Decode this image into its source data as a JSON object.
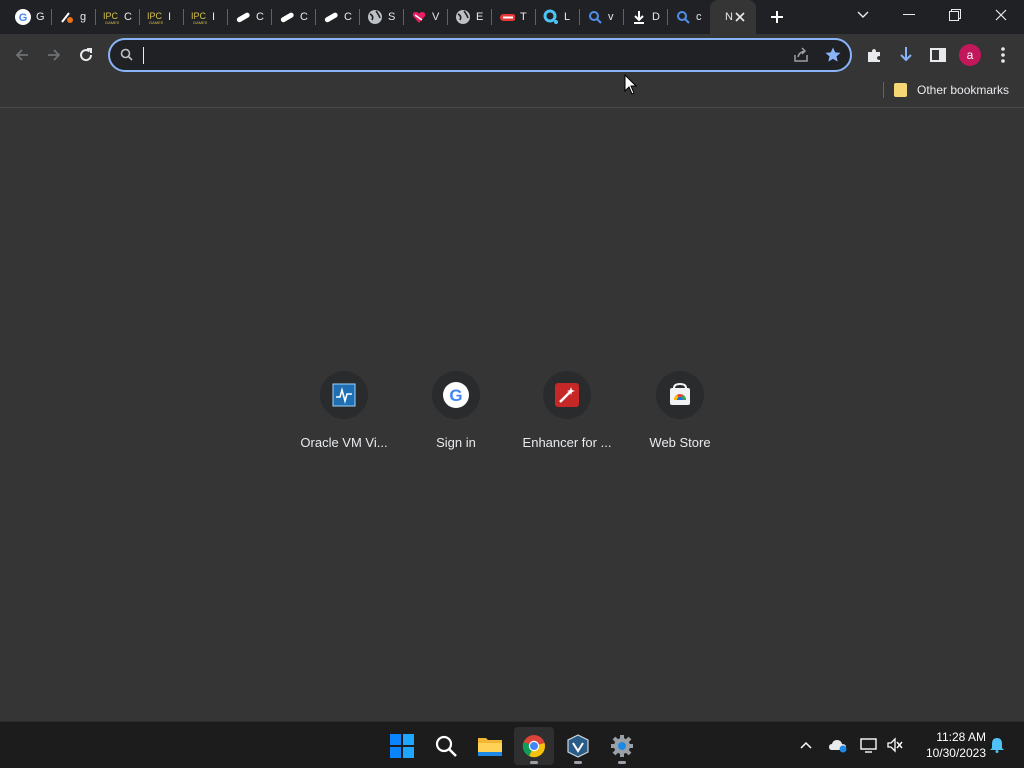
{
  "tabs": [
    {
      "title": "G",
      "icon": "google-icon"
    },
    {
      "title": "g",
      "icon": "game-icon"
    },
    {
      "title": "C",
      "icon": "ipc-games-icon"
    },
    {
      "title": "I",
      "icon": "ipc-games-icon"
    },
    {
      "title": "I",
      "icon": "ipc-games-icon"
    },
    {
      "title": "C",
      "icon": "link-icon"
    },
    {
      "title": "C",
      "icon": "link-icon"
    },
    {
      "title": "C",
      "icon": "link-icon"
    },
    {
      "title": "S",
      "icon": "globe-icon"
    },
    {
      "title": "V",
      "icon": "heart-icon"
    },
    {
      "title": "E",
      "icon": "globe-icon"
    },
    {
      "title": "T",
      "icon": "red-badge-icon"
    },
    {
      "title": "L",
      "icon": "lens-icon"
    },
    {
      "title": "v",
      "icon": "search-icon"
    },
    {
      "title": "D",
      "icon": "download-icon"
    },
    {
      "title": "c",
      "icon": "search-icon"
    }
  ],
  "active_tab": {
    "title": "N"
  },
  "omnibox": {
    "value": "",
    "placeholder": ""
  },
  "bookmarks": {
    "other_label": "Other bookmarks"
  },
  "profile": {
    "initial": "a",
    "color": "#c2185b"
  },
  "shortcuts": [
    {
      "label": "Oracle VM Vi...",
      "icon": "virtualbox-icon"
    },
    {
      "label": "Sign in",
      "icon": "google-icon"
    },
    {
      "label": "Enhancer for ...",
      "icon": "enhancer-icon"
    },
    {
      "label": "Web Store",
      "icon": "webstore-icon"
    }
  ],
  "taskbar": {
    "apps": [
      "start",
      "search",
      "file-explorer",
      "chrome",
      "virtualbox",
      "settings"
    ]
  },
  "clock": {
    "time": "11:28 AM",
    "date": "10/30/2023"
  },
  "colors": {
    "accent": "#8ab4f8",
    "background": "#353535",
    "tabstrip": "#202124"
  }
}
